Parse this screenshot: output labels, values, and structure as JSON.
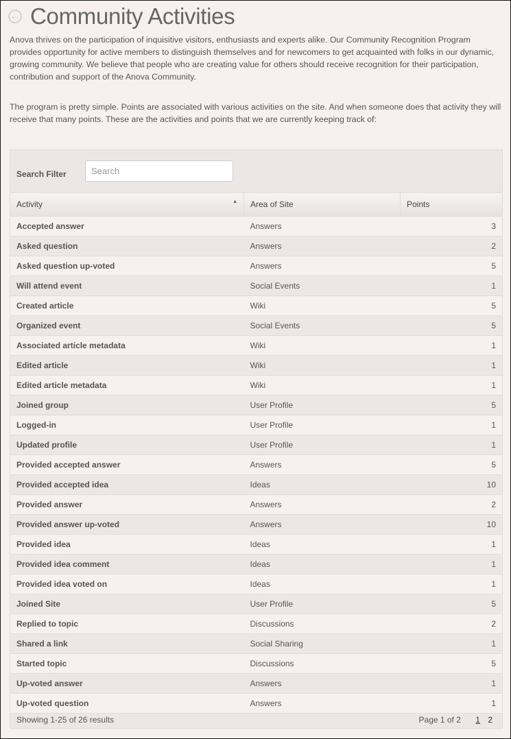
{
  "header": {
    "title": "Community Activities",
    "back_icon": "arrow-left-circle-icon"
  },
  "intro": {
    "p1": "Anova thrives on the participation of inquisitive visitors, enthusiasts and experts alike. Our Community Recognition Program provides opportunity for active members to distinguish themselves and for newcomers to get acquainted with folks in our dynamic, growing community. We believe that people who are creating value for others should receive recognition for their participation, contribution and support of the Anova Community.",
    "p2": "The program is pretty simple. Points are associated with various activities on the site. And when someone does that activity they will receive that many points. These are the activities and points that we are currently keeping track of:"
  },
  "filter": {
    "label": "Search Filter",
    "placeholder": "Search",
    "value": ""
  },
  "table": {
    "columns": [
      "Activity",
      "Area of Site",
      "Points"
    ],
    "rows": [
      [
        "Accepted answer",
        "Answers",
        "3"
      ],
      [
        "Asked question",
        "Answers",
        "2"
      ],
      [
        "Asked question up-voted",
        "Answers",
        "5"
      ],
      [
        "Will attend event",
        "Social Events",
        "1"
      ],
      [
        "Created article",
        "Wiki",
        "5"
      ],
      [
        "Organized event",
        "Social Events",
        "5"
      ],
      [
        "Associated article metadata",
        "Wiki",
        "1"
      ],
      [
        "Edited article",
        "Wiki",
        "1"
      ],
      [
        "Edited article metadata",
        "Wiki",
        "1"
      ],
      [
        "Joined group",
        "User Profile",
        "5"
      ],
      [
        "Logged-in",
        "User Profile",
        "1"
      ],
      [
        "Updated profile",
        "User Profile",
        "1"
      ],
      [
        "Provided accepted answer",
        "Answers",
        "5"
      ],
      [
        "Provided accepted idea",
        "Ideas",
        "10"
      ],
      [
        "Provided answer",
        "Answers",
        "2"
      ],
      [
        "Provided answer up-voted",
        "Answers",
        "10"
      ],
      [
        "Provided idea",
        "Ideas",
        "1"
      ],
      [
        "Provided idea comment",
        "Ideas",
        "1"
      ],
      [
        "Provided idea voted on",
        "Ideas",
        "1"
      ],
      [
        "Joined Site",
        "User Profile",
        "5"
      ],
      [
        "Replied to topic",
        "Discussions",
        "2"
      ],
      [
        "Shared a link",
        "Social Sharing",
        "1"
      ],
      [
        "Started topic",
        "Discussions",
        "5"
      ],
      [
        "Up-voted answer",
        "Answers",
        "1"
      ],
      [
        "Up-voted question",
        "Answers",
        "1"
      ]
    ]
  },
  "footer": {
    "showing": "Showing 1-25 of 26 results",
    "page_info": "Page 1 of 2",
    "pages": [
      "1",
      "2"
    ]
  }
}
